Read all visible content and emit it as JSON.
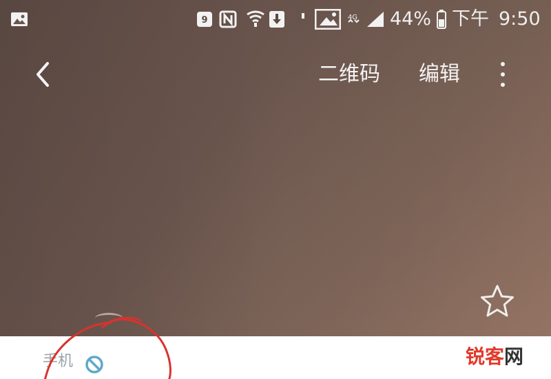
{
  "status_bar": {
    "battery_percent": "44%",
    "time_prefix": "下午",
    "time": "9:50",
    "icons": [
      "gallery-icon",
      "sim-card-icon",
      "nfc-icon",
      "wifi-icon",
      "download-icon",
      "vibrate-icon",
      "image-icon",
      "mobile-data-icon",
      "signal-icon",
      "battery-icon"
    ]
  },
  "app_bar": {
    "back_icon": "chevron-left-icon",
    "qr_code_label": "二维码",
    "edit_label": "编辑",
    "more_icon": "more-vertical-icon"
  },
  "profile": {
    "favorite_icon": "star-outline-icon",
    "phone_label": "手机",
    "status_icon": "block-icon"
  },
  "watermark": {
    "text_part1": "锐客",
    "text_part2": "网"
  },
  "colors": {
    "header_gradient_start": "#5d4a44",
    "header_gradient_end": "#a07d6c",
    "annotation_red": "#d9322e",
    "watermark_red": "#e23a2a",
    "block_icon": "#5fa9c9"
  }
}
